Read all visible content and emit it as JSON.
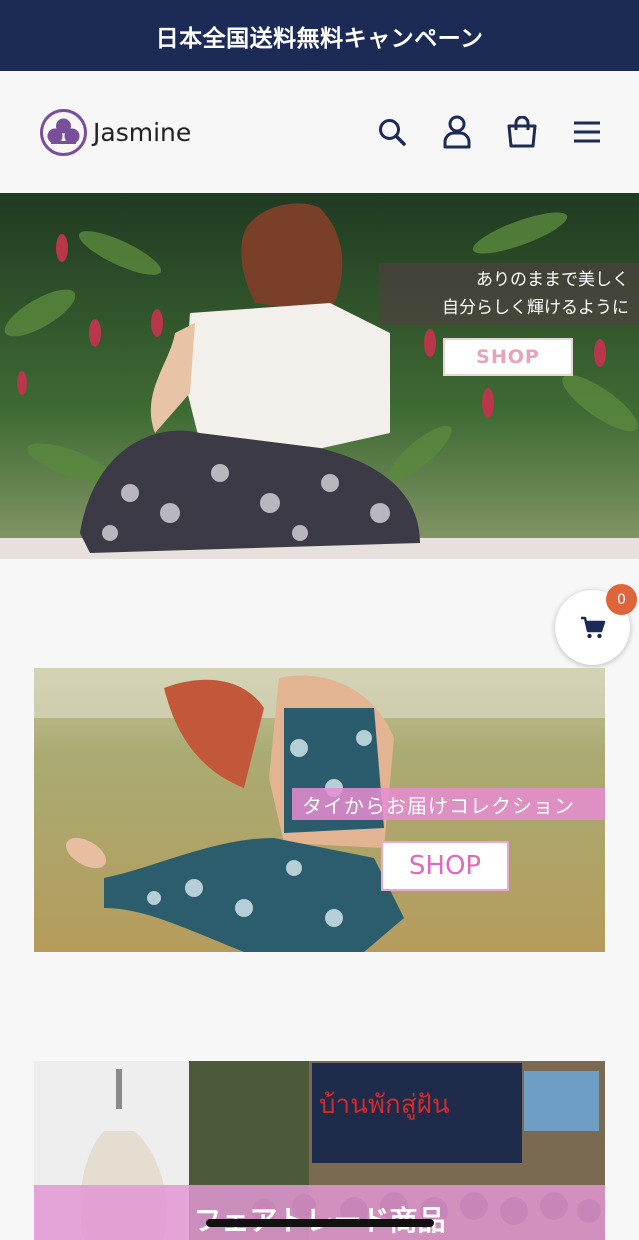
{
  "announcement": {
    "text": "日本全国送料無料キャンペーン"
  },
  "header": {
    "brand": "Jasmine",
    "icons": [
      "search-icon",
      "account-icon",
      "bag-icon",
      "menu-icon"
    ]
  },
  "hero": {
    "caption_line1": "ありのままで美しく",
    "caption_line2": "自分らしく輝けるように",
    "button": "SHOP"
  },
  "cart": {
    "count": "0"
  },
  "collection_banner": {
    "caption": "タイからお届けコレクション",
    "button": "SHOP"
  },
  "fairtrade_banner": {
    "caption": "フェアトレード商品",
    "sign_text": "บ้านพักสู่ฝัน"
  },
  "colors": {
    "announcement_bg": "#1c2b55",
    "brand_purple": "#7a4f9a",
    "cart_badge": "#e0643a",
    "pink": "#e06ab8"
  }
}
